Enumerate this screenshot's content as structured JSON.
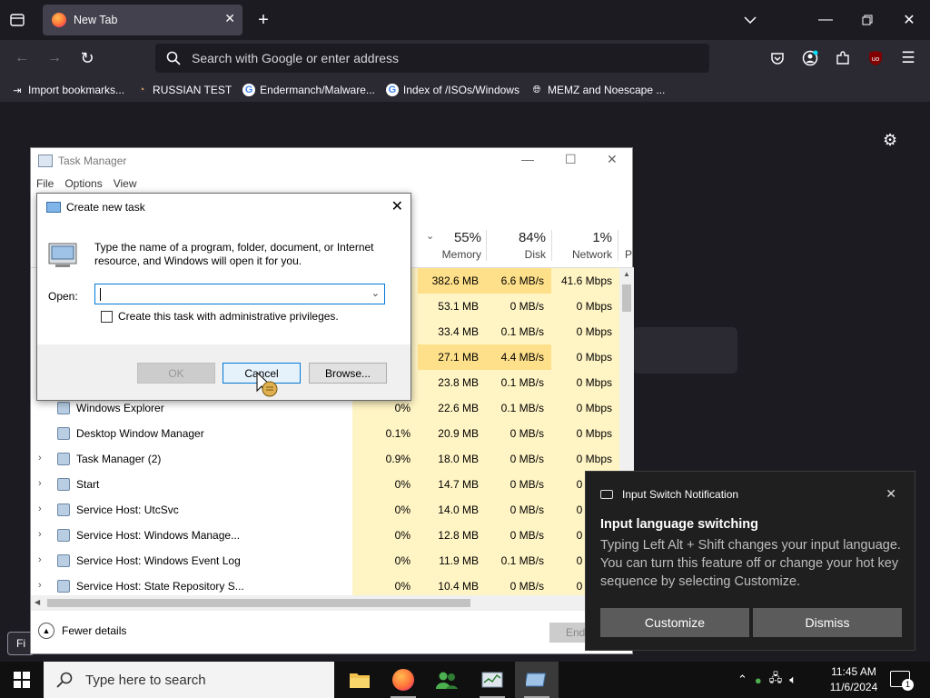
{
  "browser": {
    "tab_title": "New Tab",
    "url_placeholder": "Search with Google or enter address",
    "bookmarks": [
      "Import bookmarks...",
      "RUSSIAN TEST",
      "Endermanch/Malware...",
      "Index of /ISOs/Windows",
      "MEMZ and Noescape ..."
    ],
    "find_label": "Fi"
  },
  "task_manager": {
    "title": "Task Manager",
    "menu": [
      "File",
      "Options",
      "View"
    ],
    "columns": [
      {
        "pct": "55%",
        "label": "Memory"
      },
      {
        "pct": "84%",
        "label": "Disk"
      },
      {
        "pct": "1%",
        "label": "Network"
      },
      {
        "pct": "",
        "label": "P"
      }
    ],
    "rows": [
      {
        "name": "",
        "cpu": "",
        "mem": "382.6 MB",
        "disk": "6.6 MB/s",
        "net": "41.6 Mbps",
        "hot": true
      },
      {
        "name": "",
        "cpu": "",
        "mem": "53.1 MB",
        "disk": "0 MB/s",
        "net": "0 Mbps"
      },
      {
        "name": "",
        "cpu": "",
        "mem": "33.4 MB",
        "disk": "0.1 MB/s",
        "net": "0 Mbps"
      },
      {
        "name": "",
        "cpu": "",
        "mem": "27.1 MB",
        "disk": "4.4 MB/s",
        "net": "0 Mbps",
        "hot": true
      },
      {
        "name": "",
        "cpu": "",
        "mem": "23.8 MB",
        "disk": "0.1 MB/s",
        "net": "0 Mbps"
      },
      {
        "name": "Windows Explorer",
        "cpu": "0%",
        "mem": "22.6 MB",
        "disk": "0.1 MB/s",
        "net": "0 Mbps"
      },
      {
        "name": "Desktop Window Manager",
        "cpu": "0.1%",
        "mem": "20.9 MB",
        "disk": "0 MB/s",
        "net": "0 Mbps"
      },
      {
        "name": "Task Manager (2)",
        "cpu": "0.9%",
        "mem": "18.0 MB",
        "disk": "0 MB/s",
        "net": "0 Mbps",
        "expand": true
      },
      {
        "name": "Start",
        "cpu": "0%",
        "mem": "14.7 MB",
        "disk": "0 MB/s",
        "net": "0 Mbps",
        "expand": true
      },
      {
        "name": "Service Host: UtcSvc",
        "cpu": "0%",
        "mem": "14.0 MB",
        "disk": "0 MB/s",
        "net": "0 Mbps",
        "expand": true
      },
      {
        "name": "Service Host: Windows Manage...",
        "cpu": "0%",
        "mem": "12.8 MB",
        "disk": "0 MB/s",
        "net": "0 Mbps",
        "expand": true
      },
      {
        "name": "Service Host: Windows Event Log",
        "cpu": "0%",
        "mem": "11.9 MB",
        "disk": "0.1 MB/s",
        "net": "0 Mbps",
        "expand": true
      },
      {
        "name": "Service Host: State Repository S...",
        "cpu": "0%",
        "mem": "10.4 MB",
        "disk": "0 MB/s",
        "net": "0 Mbps",
        "expand": true
      }
    ],
    "fewer_details": "Fewer details",
    "end_task": "End"
  },
  "run_dialog": {
    "title": "Create new task",
    "description": "Type the name of a program, folder, document, or Internet resource, and Windows will open it for you.",
    "open_label": "Open:",
    "open_value": "",
    "admin_checkbox_label": "Create this task with administrative privileges.",
    "ok_label": "OK",
    "cancel_label": "Cancel",
    "browse_label": "Browse..."
  },
  "notification": {
    "app": "Input Switch Notification",
    "title": "Input language switching",
    "body": "Typing Left Alt + Shift changes your input language. You can turn this feature off or change your hot key sequence by selecting Customize.",
    "customize_label": "Customize",
    "dismiss_label": "Dismiss"
  },
  "taskbar": {
    "search_placeholder": "Type here to search",
    "time": "11:45 AM",
    "date": "11/6/2024",
    "notification_count": "1"
  }
}
